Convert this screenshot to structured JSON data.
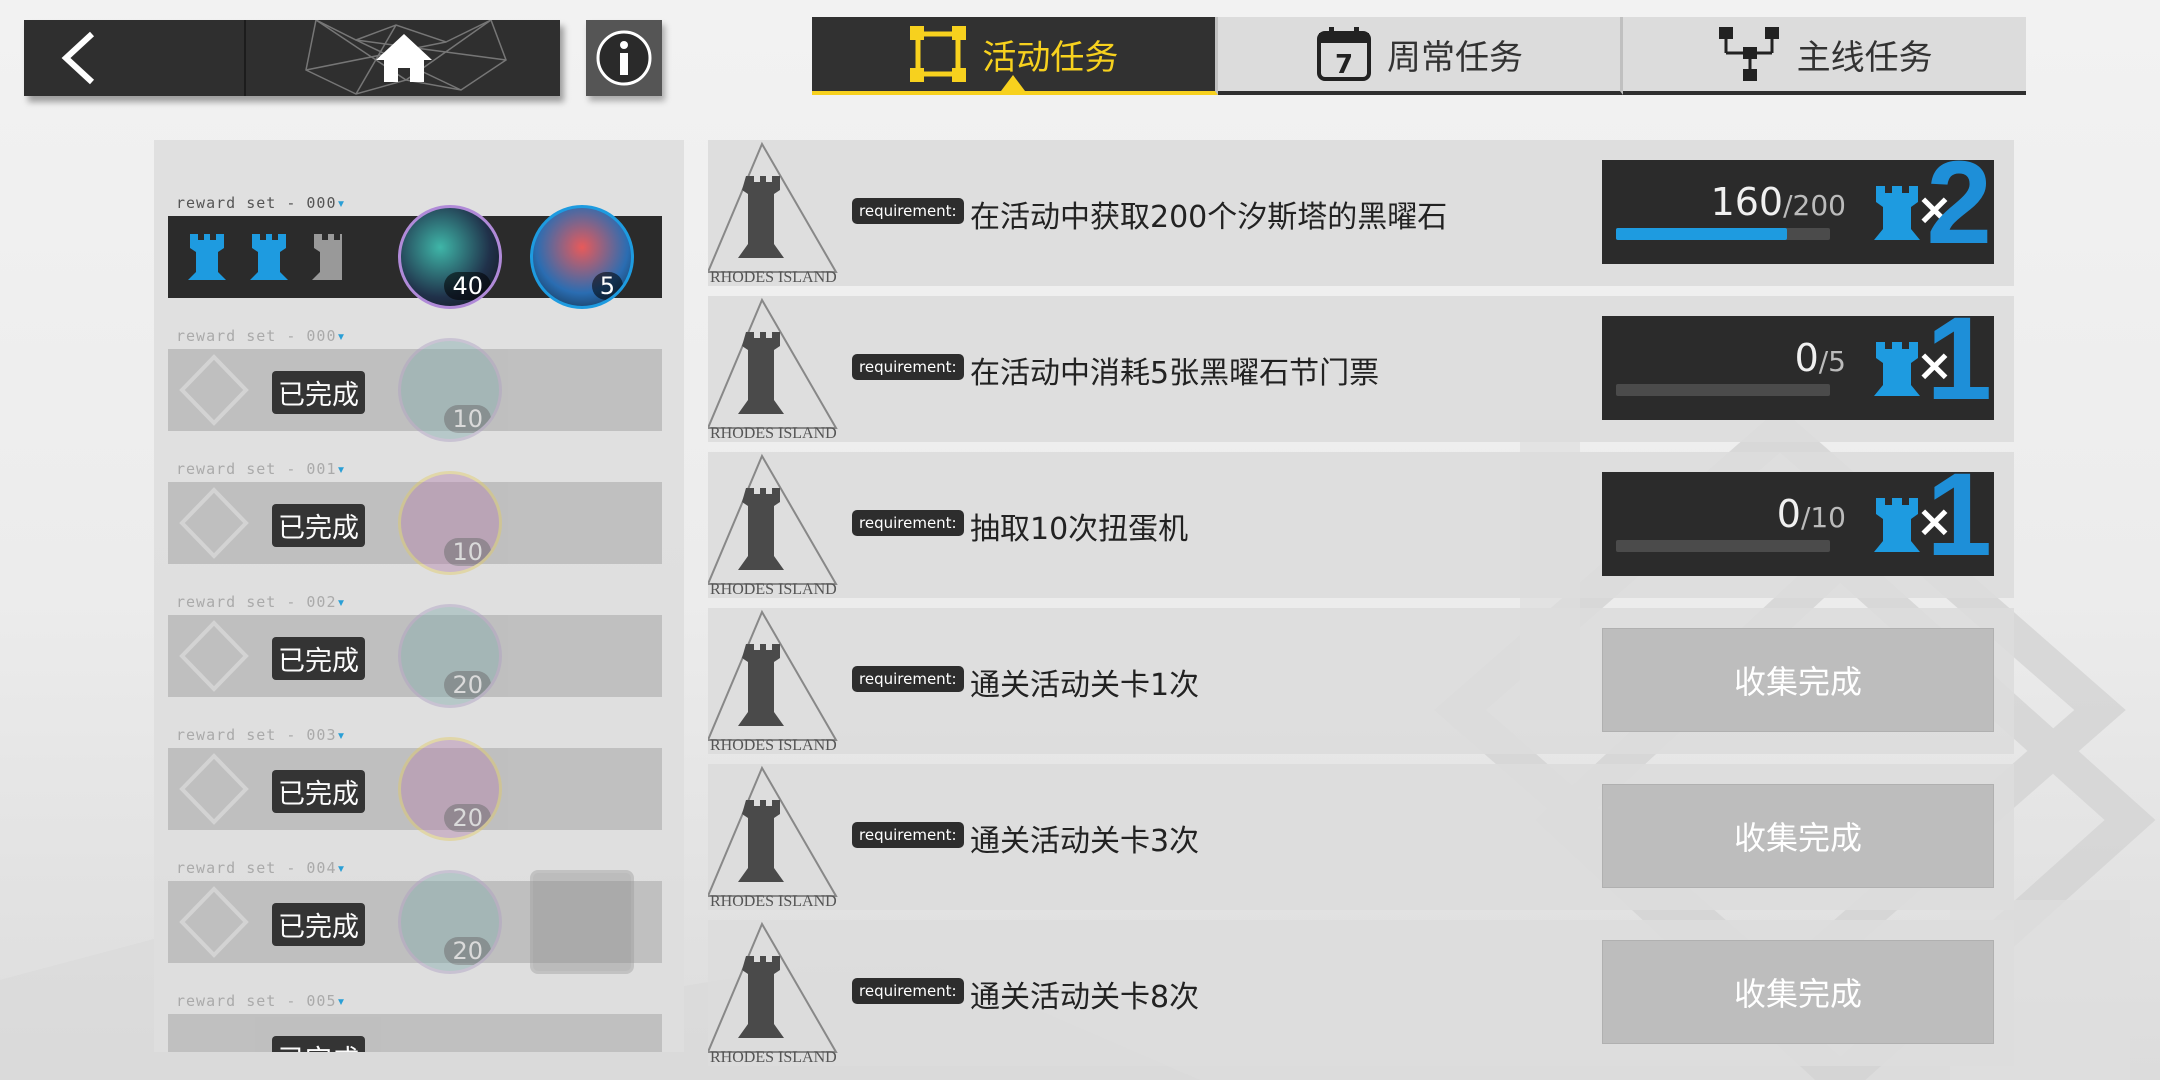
{
  "nav": {
    "back_icon": "chevron-left-icon",
    "home_icon": "home-icon",
    "info_icon": "info-icon"
  },
  "tabs": [
    {
      "label": "活动任务",
      "icon": "activity-frame-icon",
      "active": true
    },
    {
      "label": "周常任务",
      "icon": "calendar-7-icon",
      "active": false
    },
    {
      "label": "主线任务",
      "icon": "tree-icon",
      "active": false
    }
  ],
  "reward_sets": [
    {
      "label": "reward set - 000",
      "status": "current",
      "items": [
        {
          "count": "40"
        },
        {
          "count": "5"
        }
      ]
    },
    {
      "label": "reward set - 000",
      "status": "done",
      "done_label": "已完成",
      "items": [
        {
          "count": "10"
        }
      ]
    },
    {
      "label": "reward set - 001",
      "status": "done",
      "done_label": "已完成",
      "items": [
        {
          "count": "10"
        }
      ]
    },
    {
      "label": "reward set - 002",
      "status": "done",
      "done_label": "已完成",
      "items": [
        {
          "count": "20"
        }
      ]
    },
    {
      "label": "reward set - 003",
      "status": "done",
      "done_label": "已完成",
      "items": [
        {
          "count": "20"
        }
      ]
    },
    {
      "label": "reward set - 004",
      "status": "done",
      "done_label": "已完成",
      "items": [
        {
          "count": "20"
        }
      ]
    },
    {
      "label": "reward set - 005",
      "status": "done",
      "done_label": "已完成",
      "items": []
    }
  ],
  "tasks": [
    {
      "tag": "requirement:",
      "text": "在活动中获取200个汐斯塔的黑曜石",
      "type": "progress",
      "current": "160",
      "total": "/200",
      "progress": 0.8,
      "multiplier": "×",
      "qty": "2"
    },
    {
      "tag": "requirement:",
      "text": "在活动中消耗5张黑曜石节门票",
      "type": "progress",
      "current": "0",
      "total": "/5",
      "progress": 0,
      "multiplier": "×",
      "qty": "1"
    },
    {
      "tag": "requirement:",
      "text": "抽取10次扭蛋机",
      "type": "progress",
      "current": "0",
      "total": "/10",
      "progress": 0,
      "multiplier": "×",
      "qty": "1"
    },
    {
      "tag": "requirement:",
      "text": "通关活动关卡1次",
      "type": "collected",
      "button": "收集完成"
    },
    {
      "tag": "requirement:",
      "text": "通关活动关卡3次",
      "type": "collected",
      "button": "收集完成"
    },
    {
      "tag": "requirement:",
      "text": "通关活动关卡8次",
      "type": "collected",
      "button": "收集完成"
    }
  ],
  "colors": {
    "accent_yellow": "#f7d11e",
    "accent_blue": "#1e9be0",
    "dark_panel": "#2b2b2b"
  }
}
